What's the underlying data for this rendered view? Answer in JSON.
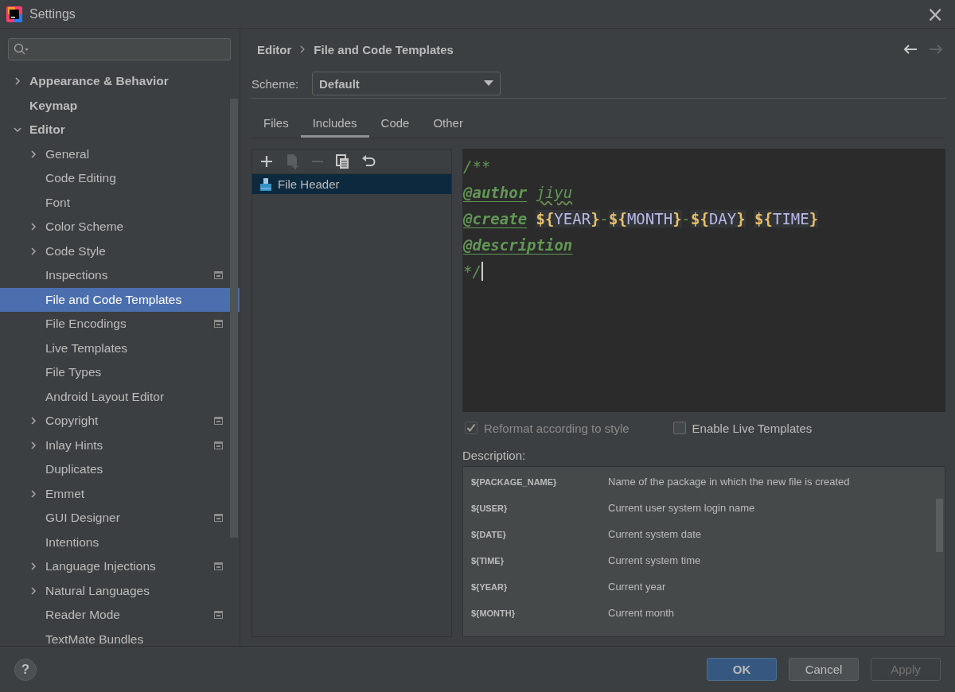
{
  "window": {
    "title": "Settings",
    "close": "×"
  },
  "sidebar": {
    "items": [
      {
        "label": "Appearance & Behavior",
        "kind": "folder",
        "expanded": false,
        "selected": false,
        "project_icon": false
      },
      {
        "label": "Keymap",
        "kind": "leaf",
        "selected": false,
        "project_icon": false
      },
      {
        "label": "Editor",
        "kind": "folder",
        "expanded": true,
        "selected": false,
        "project_icon": false,
        "children": [
          {
            "label": "General",
            "kind": "folder",
            "expanded": false,
            "selected": false,
            "project_icon": false
          },
          {
            "label": "Code Editing",
            "kind": "leaf",
            "selected": false,
            "project_icon": false
          },
          {
            "label": "Font",
            "kind": "leaf",
            "selected": false,
            "project_icon": false
          },
          {
            "label": "Color Scheme",
            "kind": "folder",
            "expanded": false,
            "selected": false,
            "project_icon": false
          },
          {
            "label": "Code Style",
            "kind": "folder",
            "expanded": false,
            "selected": false,
            "project_icon": false
          },
          {
            "label": "Inspections",
            "kind": "leaf",
            "selected": false,
            "project_icon": true
          },
          {
            "label": "File and Code Templates",
            "kind": "leaf",
            "selected": true,
            "project_icon": false
          },
          {
            "label": "File Encodings",
            "kind": "leaf",
            "selected": false,
            "project_icon": true
          },
          {
            "label": "Live Templates",
            "kind": "leaf",
            "selected": false,
            "project_icon": false
          },
          {
            "label": "File Types",
            "kind": "leaf",
            "selected": false,
            "project_icon": false
          },
          {
            "label": "Android Layout Editor",
            "kind": "leaf",
            "selected": false,
            "project_icon": false
          },
          {
            "label": "Copyright",
            "kind": "folder",
            "expanded": false,
            "selected": false,
            "project_icon": true
          },
          {
            "label": "Inlay Hints",
            "kind": "folder",
            "expanded": false,
            "selected": false,
            "project_icon": true
          },
          {
            "label": "Duplicates",
            "kind": "leaf",
            "selected": false,
            "project_icon": false
          },
          {
            "label": "Emmet",
            "kind": "folder",
            "expanded": false,
            "selected": false,
            "project_icon": false
          },
          {
            "label": "GUI Designer",
            "kind": "leaf",
            "selected": false,
            "project_icon": true
          },
          {
            "label": "Intentions",
            "kind": "leaf",
            "selected": false,
            "project_icon": false
          },
          {
            "label": "Language Injections",
            "kind": "folder",
            "expanded": false,
            "selected": false,
            "project_icon": true
          },
          {
            "label": "Natural Languages",
            "kind": "folder",
            "expanded": false,
            "selected": false,
            "project_icon": false
          },
          {
            "label": "Reader Mode",
            "kind": "leaf",
            "selected": false,
            "project_icon": true
          },
          {
            "label": "TextMate Bundles",
            "kind": "leaf",
            "selected": false,
            "project_icon": false
          }
        ]
      }
    ]
  },
  "breadcrumb": [
    "Editor",
    "File and Code Templates"
  ],
  "navigation": {
    "back_enabled": true,
    "forward_enabled": false
  },
  "scheme": {
    "label": "Scheme:",
    "value": "Default"
  },
  "tabs": [
    {
      "label": "Files",
      "selected": false
    },
    {
      "label": "Includes",
      "selected": true
    },
    {
      "label": "Code",
      "selected": false
    },
    {
      "label": "Other",
      "selected": false
    }
  ],
  "toolbar": [
    {
      "kind": "add",
      "disabled": false
    },
    {
      "kind": "add_child",
      "disabled": true
    },
    {
      "kind": "remove",
      "disabled": true
    },
    {
      "kind": "copy",
      "disabled": false
    },
    {
      "kind": "reset",
      "disabled": false
    }
  ],
  "templates": [
    {
      "label": "File Header",
      "selected": true
    }
  ],
  "editor": {
    "lines": [
      {
        "caret": false,
        "segments": [
          {
            "kind": "comment",
            "text": "/**"
          }
        ]
      },
      {
        "caret": false,
        "segments": [
          {
            "kind": "tag",
            "text": "@author"
          },
          {
            "kind": "gap"
          },
          {
            "kind": "typo",
            "text": "jiyu"
          }
        ]
      },
      {
        "caret": false,
        "segments": [
          {
            "kind": "tag",
            "text": "@create"
          },
          {
            "kind": "gap"
          },
          {
            "kind": "variable",
            "open": "${",
            "name": "YEAR",
            "close": "}"
          },
          {
            "kind": "comment",
            "text": "-"
          },
          {
            "kind": "variable",
            "open": "${",
            "name": "MONTH",
            "close": "}"
          },
          {
            "kind": "comment",
            "text": "-"
          },
          {
            "kind": "variable",
            "open": "${",
            "name": "DAY",
            "close": "}"
          },
          {
            "kind": "gap"
          },
          {
            "kind": "variable",
            "open": "${",
            "name": "TIME",
            "close": "}"
          }
        ]
      },
      {
        "caret": false,
        "segments": [
          {
            "kind": "tag",
            "text": "@description"
          }
        ]
      },
      {
        "caret": true,
        "segments": [
          {
            "kind": "comment",
            "text": "*/"
          }
        ]
      }
    ]
  },
  "options": [
    {
      "label": "Reformat according to style",
      "checked": true,
      "disabled": true
    },
    {
      "label": "Enable Live Templates",
      "checked": false,
      "disabled": false
    }
  ],
  "description": {
    "label": "Description:",
    "rows": [
      {
        "variable": "${PACKAGE_NAME}",
        "text": "Name of the package in which the new file is created"
      },
      {
        "variable": "${USER}",
        "text": "Current user system login name"
      },
      {
        "variable": "${DATE}",
        "text": "Current system date"
      },
      {
        "variable": "${TIME}",
        "text": "Current system time"
      },
      {
        "variable": "${YEAR}",
        "text": "Current year"
      },
      {
        "variable": "${MONTH}",
        "text": "Current month"
      }
    ]
  },
  "help": "?",
  "buttons": [
    {
      "label": "OK",
      "default": true,
      "disabled": false
    },
    {
      "label": "Cancel",
      "default": false,
      "disabled": false
    },
    {
      "label": "Apply",
      "default": false,
      "disabled": true
    }
  ]
}
